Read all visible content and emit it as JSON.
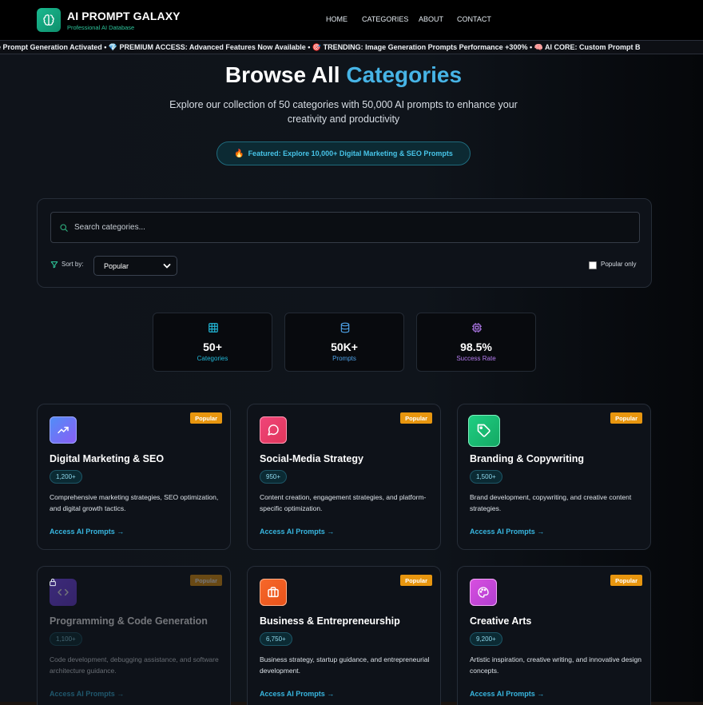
{
  "header": {
    "brand_title": "AI PROMPT GALAXY",
    "brand_subtitle": "Professional AI Database",
    "nav": [
      "HOME",
      "CATEGORIES",
      "ABOUT",
      "CONTACT"
    ]
  },
  "ticker": {
    "text": "e Prompt Generation Activated • 💎 PREMIUM ACCESS: Advanced Features Now Available • 🎯 TRENDING: Image Generation Prompts Performance +300% • 🧠 AI CORE: Custom Prompt B"
  },
  "hero": {
    "title_main": "Browse All ",
    "title_accent": "Categories",
    "description": "Explore our collection of 50 categories with 50,000 AI prompts to enhance your creativity and productivity",
    "featured": "Featured: Explore 10,000+ Digital Marketing & SEO Prompts"
  },
  "search": {
    "placeholder": "Search categories...",
    "sort_label": "Sort by:",
    "sort_value": "Popular",
    "popular_only_label": "Popular only",
    "popular_only_checked": false
  },
  "stats": [
    {
      "value": "50+",
      "label": "Categories",
      "color": "#22b8d8",
      "icon": "grid-icon"
    },
    {
      "value": "50K+",
      "label": "Prompts",
      "color": "#4ea2e8",
      "icon": "database-icon"
    },
    {
      "value": "98.5%",
      "label": "Success Rate",
      "color": "#b57cf0",
      "icon": "cpu-icon"
    }
  ],
  "cards": [
    {
      "title": "Digital Marketing & SEO",
      "count": "1,200+",
      "badge": "Popular",
      "description": "Comprehensive marketing strategies, SEO optimization, and digital growth tactics.",
      "link": "Access AI Prompts →",
      "icon": "trending-up-icon",
      "color": "#6b74f0",
      "locked": false
    },
    {
      "title": "Social-Media Strategy",
      "count": "950+",
      "badge": "Popular",
      "description": "Content creation, engagement strategies, and platform-specific optimization.",
      "link": "Access AI Prompts →",
      "icon": "message-icon",
      "color": "#e8466f",
      "locked": false
    },
    {
      "title": "Branding & Copywriting",
      "count": "1,500+",
      "badge": "Popular",
      "description": "Brand development, copywriting, and creative content strategies.",
      "link": "Access AI Prompts →",
      "icon": "tag-icon",
      "color": "#22b871",
      "locked": false
    },
    {
      "title": "Programming & Code Generation",
      "count": "1,100+",
      "badge": "Popular",
      "description": "Code development, debugging assistance, and software architecture guidance.",
      "link": "Access AI Prompts →",
      "icon": "code-icon",
      "color": "#7b5cf0",
      "locked": true
    },
    {
      "title": "Business & Entrepreneurship",
      "count": "6,750+",
      "badge": "Popular",
      "description": "Business strategy, startup guidance, and entrepreneurial development.",
      "link": "Access AI Prompts →",
      "icon": "briefcase-icon",
      "color": "#f06a2e",
      "locked": false
    },
    {
      "title": "Creative Arts",
      "count": "9,200+",
      "badge": "Popular",
      "description": "Artistic inspiration, creative writing, and innovative design concepts.",
      "link": "Access AI Prompts →",
      "icon": "palette-icon",
      "color": "#c64ee0",
      "locked": false
    }
  ]
}
